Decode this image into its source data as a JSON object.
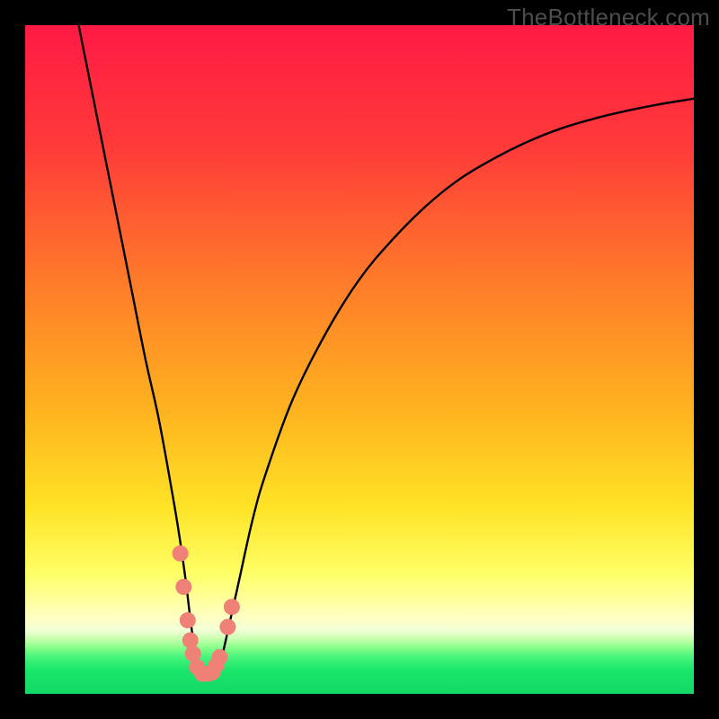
{
  "watermark": "TheBottleneck.com",
  "chart_data": {
    "type": "line",
    "title": "",
    "xlabel": "",
    "ylabel": "",
    "xlim": [
      0,
      100
    ],
    "ylim": [
      0,
      100
    ],
    "grid": false,
    "legend": false,
    "background_gradient_stops": [
      {
        "offset": 0.0,
        "color": "#ff1a44"
      },
      {
        "offset": 0.18,
        "color": "#ff3a3a"
      },
      {
        "offset": 0.38,
        "color": "#ff7a2a"
      },
      {
        "offset": 0.58,
        "color": "#ffb41f"
      },
      {
        "offset": 0.72,
        "color": "#ffe326"
      },
      {
        "offset": 0.82,
        "color": "#ffff66"
      },
      {
        "offset": 0.885,
        "color": "#ffffc2"
      },
      {
        "offset": 0.905,
        "color": "#f2ffd6"
      },
      {
        "offset": 0.918,
        "color": "#c8ffb0"
      },
      {
        "offset": 0.93,
        "color": "#8cff8c"
      },
      {
        "offset": 0.945,
        "color": "#46f57a"
      },
      {
        "offset": 0.965,
        "color": "#18e66b"
      },
      {
        "offset": 1.0,
        "color": "#14d865"
      }
    ],
    "series": [
      {
        "name": "bottleneck-curve",
        "color": "#000000",
        "x": [
          8,
          10,
          12,
          14,
          16,
          18,
          20,
          22,
          23,
          24,
          25,
          26,
          27,
          28,
          29,
          30,
          32,
          34,
          36,
          40,
          45,
          50,
          55,
          60,
          65,
          70,
          75,
          80,
          85,
          90,
          95,
          100
        ],
        "y": [
          100,
          90,
          80,
          70,
          60,
          50,
          41,
          30,
          24,
          17,
          9,
          4,
          3,
          3,
          4,
          8,
          17,
          26,
          33,
          44,
          54,
          62,
          68,
          73,
          77,
          80,
          82.5,
          84.5,
          86,
          87.2,
          88.2,
          89
        ]
      }
    ],
    "markers": {
      "name": "highlight-markers",
      "color": "#f08176",
      "points": [
        {
          "x": 23.2,
          "y": 21
        },
        {
          "x": 23.7,
          "y": 16
        },
        {
          "x": 24.3,
          "y": 11
        },
        {
          "x": 24.7,
          "y": 8
        },
        {
          "x": 25.1,
          "y": 6
        },
        {
          "x": 25.7,
          "y": 4
        },
        {
          "x": 26.5,
          "y": 3
        },
        {
          "x": 27.3,
          "y": 3
        },
        {
          "x": 28.0,
          "y": 3.2
        },
        {
          "x": 28.6,
          "y": 4.3
        },
        {
          "x": 29.1,
          "y": 5.5
        },
        {
          "x": 30.3,
          "y": 10
        },
        {
          "x": 30.9,
          "y": 13
        }
      ]
    }
  }
}
